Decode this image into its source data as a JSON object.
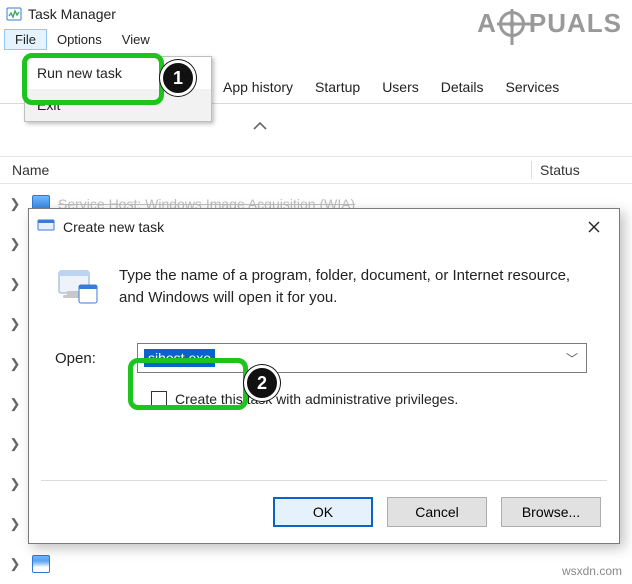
{
  "window": {
    "title": "Task Manager",
    "menubar": {
      "file": "File",
      "options": "Options",
      "view": "View"
    },
    "file_menu": {
      "run_new_task": "Run new task",
      "exit": "Exit"
    },
    "tabs": {
      "app_history": "App history",
      "startup": "Startup",
      "users": "Users",
      "details": "Details",
      "services": "Services"
    },
    "columns": {
      "name": "Name",
      "status": "Status"
    },
    "row0": "Service Host: Windows Image Acquisition (WIA)"
  },
  "dialog": {
    "title": "Create new task",
    "message": "Type the name of a program, folder, document, or Internet resource, and Windows will open it for you.",
    "open_label": "Open:",
    "open_value": "sihost.exe",
    "admin_label": "Create this task with administrative privileges.",
    "ok": "OK",
    "cancel": "Cancel",
    "browse": "Browse..."
  },
  "badges": {
    "one": "1",
    "two": "2"
  },
  "watermark": {
    "left": "A",
    "right": "PUALS"
  },
  "credit": "wsxdn.com"
}
